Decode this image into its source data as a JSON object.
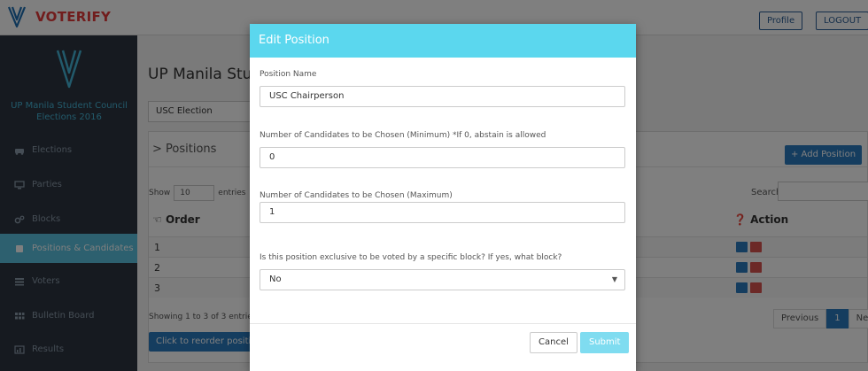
{
  "app": {
    "name": "VOTERIFY"
  },
  "header": {
    "profile_label": "Profile",
    "logout_label": "LOGOUT"
  },
  "sidebar": {
    "title": "UP Manila Student Council Elections 2016",
    "items": [
      {
        "label": "Elections",
        "icon": "car-icon"
      },
      {
        "label": "Parties",
        "icon": "monitor-icon"
      },
      {
        "label": "Blocks",
        "icon": "cogs-icon"
      },
      {
        "label": "Positions & Candidates",
        "icon": "users-icon",
        "active": true
      },
      {
        "label": "Voters",
        "icon": "list-icon"
      },
      {
        "label": "Bulletin Board",
        "icon": "grid-icon"
      },
      {
        "label": "Results",
        "icon": "chart-icon"
      }
    ]
  },
  "main": {
    "page_title": "UP Manila Stud",
    "election_select": "USC Election",
    "panel_title": "> Positions",
    "add_button": "+ Add Position",
    "show_label": "Show",
    "show_value": "10",
    "entries_label": "entries",
    "search_label": "Search:",
    "columns": {
      "order": "Order",
      "action": "Action"
    },
    "rows": [
      "1",
      "2",
      "3"
    ],
    "showing_text": "Showing 1 to 3 of 3 entries",
    "reorder_button": "Click to reorder positio",
    "pager": {
      "previous": "Previous",
      "current": "1",
      "next": "Next"
    }
  },
  "modal": {
    "title": "Edit Position",
    "fields": {
      "position_name_label": "Position Name",
      "position_name_value": "USC Chairperson",
      "min_label": "Number of Candidates to be Chosen (Minimum) *If 0, abstain is allowed",
      "min_value": "0",
      "max_label": "Number of Candidates to be Chosen (Maximum)",
      "max_value": "1",
      "block_label": "Is this position exclusive to be voted by a specific block? If yes, what block?",
      "block_value": "No"
    },
    "cancel_label": "Cancel",
    "submit_label": "Submit"
  },
  "colors": {
    "brand": "#e23b3b",
    "sidebar_bg": "#2d3540",
    "accent": "#5bc0de",
    "modal_header": "#5bd7ee",
    "primary_button": "#2b7bbf"
  }
}
